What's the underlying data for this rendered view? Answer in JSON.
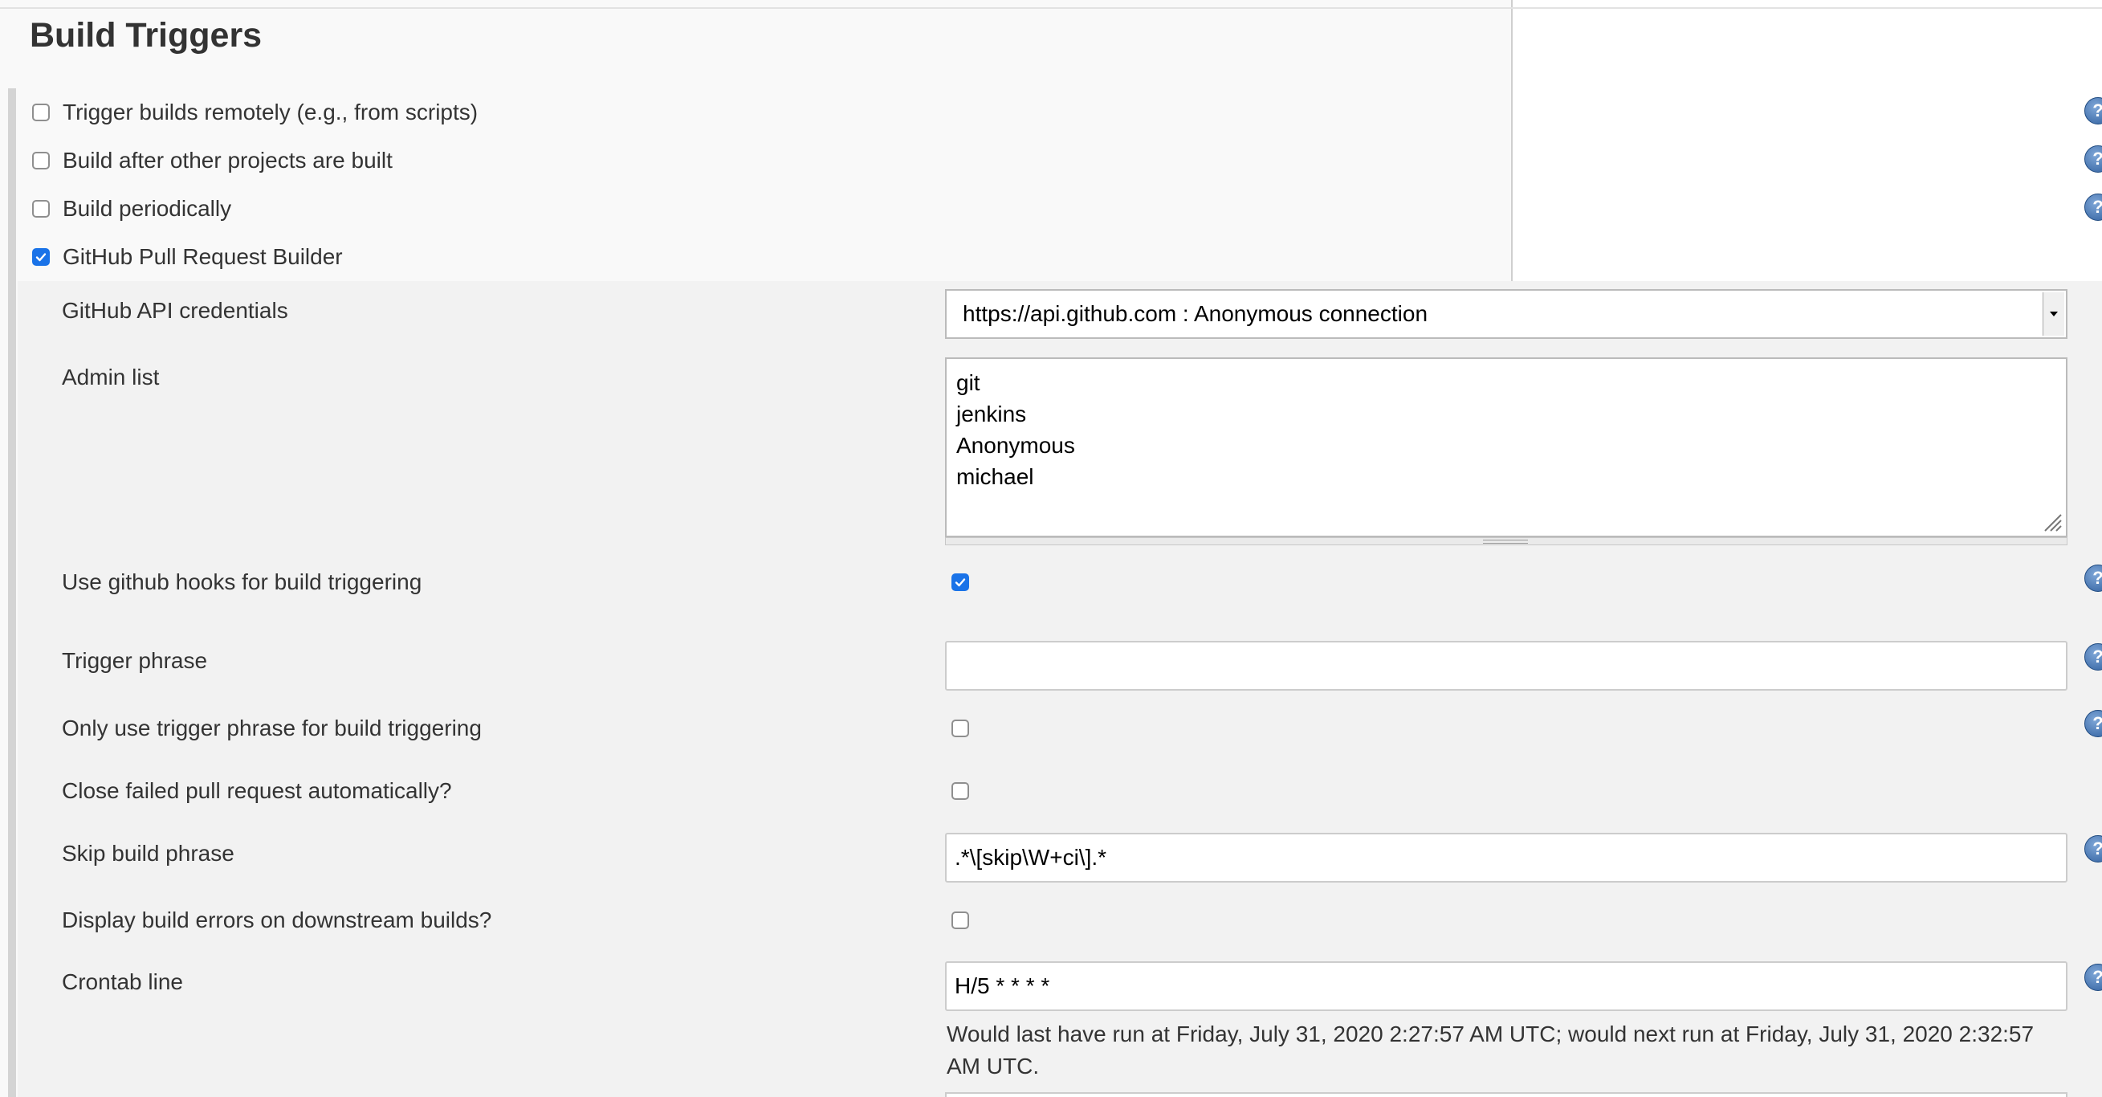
{
  "section_title": "Build Triggers",
  "triggers": [
    {
      "label": "Trigger builds remotely (e.g., from scripts)",
      "checked": false
    },
    {
      "label": "Build after other projects are built",
      "checked": false
    },
    {
      "label": "Build periodically",
      "checked": false
    },
    {
      "label": "GitHub Pull Request Builder",
      "checked": true
    }
  ],
  "ghprb": {
    "credentials": {
      "label": "GitHub API credentials",
      "value": "https://api.github.com : Anonymous connection"
    },
    "admin_list": {
      "label": "Admin list",
      "lines": [
        "git",
        "jenkins",
        "Anonymous",
        "michael"
      ]
    },
    "use_hooks": {
      "label": "Use github hooks for build triggering",
      "checked": true
    },
    "trigger_phrase": {
      "label": "Trigger phrase",
      "value": ""
    },
    "only_trigger_phrase": {
      "label": "Only use trigger phrase for build triggering",
      "checked": false
    },
    "close_failed": {
      "label": "Close failed pull request automatically?",
      "checked": false
    },
    "skip_build_phrase": {
      "label": "Skip build phrase",
      "value": ".*\\[skip\\W+ci\\].*"
    },
    "display_errors": {
      "label": "Display build errors on downstream builds?",
      "checked": false
    },
    "crontab": {
      "label": "Crontab line",
      "value": "H/5 * * * *",
      "note": "Would last have run at Friday, July 31, 2020 2:27:57 AM UTC; would next run at Friday, July 31, 2020 2:32:57 AM UTC."
    }
  },
  "help_icon_glyph": "?",
  "colors": {
    "checkbox_checked": "#1a73e8",
    "help_icon": "#2f5f9e"
  }
}
